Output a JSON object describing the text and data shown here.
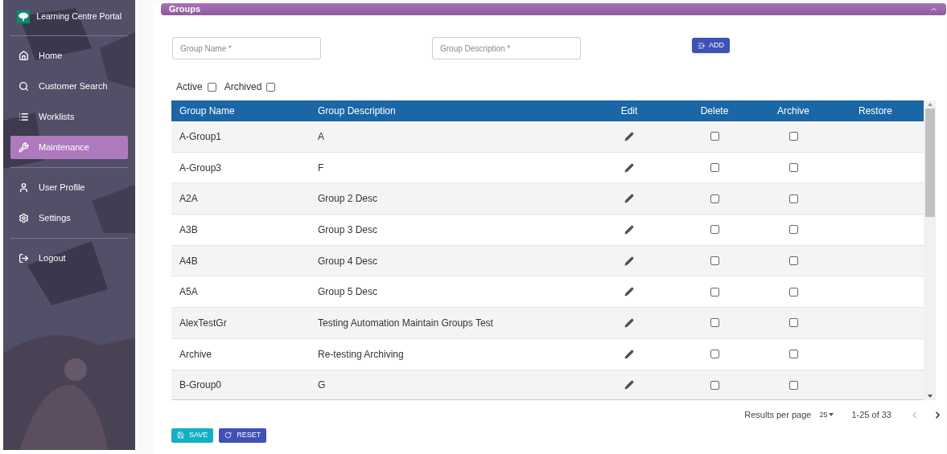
{
  "sidebar": {
    "brand": "Learning Centre Portal",
    "groups": [
      {
        "items": [
          {
            "label": "Home",
            "selected": false
          },
          {
            "label": "Customer Search",
            "selected": false
          },
          {
            "label": "Worklists",
            "selected": false
          },
          {
            "label": "Maintenance",
            "selected": true
          }
        ]
      },
      {
        "items": [
          {
            "label": "User Profile",
            "selected": false
          },
          {
            "label": "Settings",
            "selected": false
          }
        ]
      },
      {
        "items": [
          {
            "label": "Logout",
            "selected": false
          }
        ]
      }
    ]
  },
  "panel": {
    "title": "Groups",
    "expanded": true
  },
  "form": {
    "name_placeholder": "Group Name *",
    "description_placeholder": "Group Description *",
    "add_button": "ADD"
  },
  "filters": [
    {
      "label": "Active",
      "checked": false
    },
    {
      "label": "Archived",
      "checked": false
    }
  ],
  "table": {
    "columns": [
      "Group Name",
      "Group Description",
      "Edit",
      "Delete",
      "Archive",
      "Restore"
    ],
    "rows": [
      {
        "name": "A-Group1",
        "description": "A",
        "delete": false,
        "archive": false
      },
      {
        "name": "A-Group3",
        "description": "F",
        "delete": false,
        "archive": false
      },
      {
        "name": "A2A",
        "description": "Group 2 Desc",
        "delete": false,
        "archive": false
      },
      {
        "name": "A3B",
        "description": "Group 3 Desc",
        "delete": false,
        "archive": false
      },
      {
        "name": "A4B",
        "description": "Group 4 Desc",
        "delete": false,
        "archive": false
      },
      {
        "name": "A5A",
        "description": "Group 5 Desc",
        "delete": false,
        "archive": false
      },
      {
        "name": "AlexTestGr",
        "description": "Testing Automation Maintain Groups Test",
        "delete": false,
        "archive": false
      },
      {
        "name": "Archive",
        "description": "Re-testing Archiving",
        "delete": false,
        "archive": false
      },
      {
        "name": "B-Group0",
        "description": "G",
        "delete": false,
        "archive": false
      }
    ]
  },
  "pagination": {
    "label": "Results per page",
    "per_page": "25",
    "range": "1-25 of 33"
  },
  "buttons": [
    {
      "kind": "save",
      "label": "SAVE"
    },
    {
      "kind": "reset",
      "label": "RESET"
    }
  ]
}
